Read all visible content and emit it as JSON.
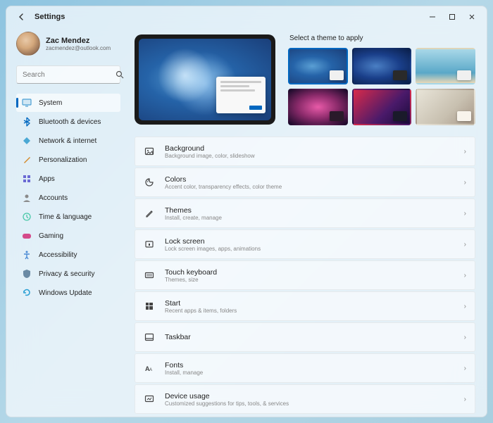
{
  "window": {
    "title": "Settings"
  },
  "user": {
    "name": "Zac Mendez",
    "email": "zacmendez@outlook.com"
  },
  "search": {
    "placeholder": "Search"
  },
  "nav": [
    {
      "icon": "display-icon",
      "color": "#4a9fd4",
      "label": "System",
      "active": true
    },
    {
      "icon": "bluetooth-icon",
      "color": "#0067c0",
      "label": "Bluetooth & devices"
    },
    {
      "icon": "network-icon",
      "color": "#4aa8d4",
      "label": "Network & internet"
    },
    {
      "icon": "brush-icon",
      "color": "#d48a2a",
      "label": "Personalization"
    },
    {
      "icon": "apps-icon",
      "color": "#6a6ad4",
      "label": "Apps"
    },
    {
      "icon": "account-icon",
      "color": "#8a8a8a",
      "label": "Accounts"
    },
    {
      "icon": "time-icon",
      "color": "#4ac8a8",
      "label": "Time & language"
    },
    {
      "icon": "gaming-icon",
      "color": "#d44a8a",
      "label": "Gaming"
    },
    {
      "icon": "accessibility-icon",
      "color": "#4a8ad4",
      "label": "Accessibility"
    },
    {
      "icon": "privacy-icon",
      "color": "#6a8aa4",
      "label": "Privacy & security"
    },
    {
      "icon": "update-icon",
      "color": "#2a9fd4",
      "label": "Windows Update"
    }
  ],
  "themes": {
    "title": "Select a theme to apply",
    "tiles": [
      "t1",
      "t2",
      "t3",
      "t4",
      "t5",
      "t6"
    ],
    "selected": 0
  },
  "settings": [
    {
      "icon": "image-icon",
      "title": "Background",
      "sub": "Background image, color, slideshow"
    },
    {
      "icon": "palette-icon",
      "title": "Colors",
      "sub": "Accent color, transparency effects, color theme"
    },
    {
      "icon": "pen-icon",
      "title": "Themes",
      "sub": "Install, create, manage"
    },
    {
      "icon": "lock-icon",
      "title": "Lock screen",
      "sub": "Lock screen images, apps, animations"
    },
    {
      "icon": "keyboard-icon",
      "title": "Touch keyboard",
      "sub": "Themes, size"
    },
    {
      "icon": "start-icon",
      "title": "Start",
      "sub": "Recent apps & items, folders"
    },
    {
      "icon": "taskbar-icon",
      "title": "Taskbar",
      "sub": ""
    },
    {
      "icon": "fonts-icon",
      "title": "Fonts",
      "sub": "Install, manage"
    },
    {
      "icon": "usage-icon",
      "title": "Device usage",
      "sub": "Customized suggestions for tips, tools, & services"
    }
  ]
}
